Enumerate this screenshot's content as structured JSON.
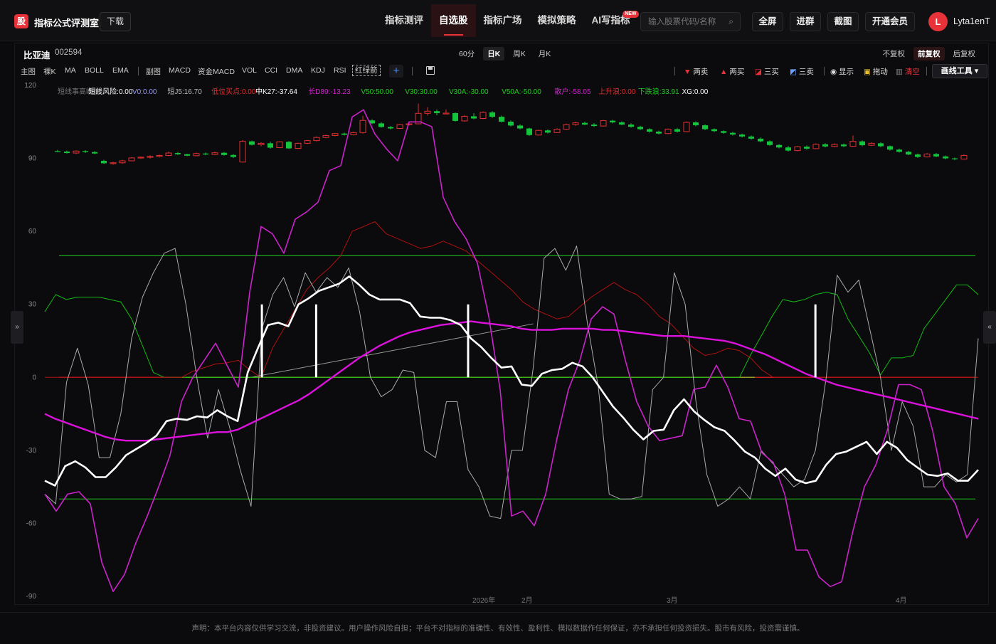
{
  "header": {
    "logo_char": "股",
    "app_title": "指标公式评测室",
    "download_label": "下载",
    "nav": [
      {
        "label": "指标测评",
        "active": false
      },
      {
        "label": "自选股",
        "active": true
      },
      {
        "label": "指标广场",
        "active": false
      },
      {
        "label": "模拟策略",
        "active": false
      },
      {
        "label": "AI写指标",
        "active": false,
        "badge": "NEW"
      }
    ],
    "search_placeholder": "输入股票代码/名称",
    "buttons": {
      "fullscreen": "全屏",
      "join_group": "进群",
      "screenshot": "截图",
      "vip": "开通会员"
    },
    "avatar_initial": "L",
    "username": "Lyta1enT"
  },
  "stock": {
    "name": "比亚迪",
    "code": "002594"
  },
  "periods": [
    {
      "label": "60分",
      "active": false
    },
    {
      "label": "日K",
      "active": true
    },
    {
      "label": "周K",
      "active": false
    },
    {
      "label": "月K",
      "active": false
    }
  ],
  "adjust": [
    {
      "label": "不复权",
      "active": false
    },
    {
      "label": "前复权",
      "active": true
    },
    {
      "label": "后复权",
      "active": false
    }
  ],
  "indicators_main": [
    "主图",
    "裸K",
    "MA",
    "BOLL",
    "EMA"
  ],
  "indicators_sub": [
    "副图",
    "MACD",
    "资金MACD",
    "VOL",
    "CCI",
    "DMA",
    "KDJ",
    "RSI",
    "红绿箭"
  ],
  "active_indicator": "红绿箭",
  "tools": {
    "sell2": "两卖",
    "buy2": "两买",
    "buy3": "三买",
    "sell3": "三卖",
    "show": "显示",
    "drag": "拖动",
    "clear": "清空",
    "draw_tools": "画线工具"
  },
  "legend": [
    {
      "text": "短线事高峰信",
      "color": "#777777"
    },
    {
      "text": "短线风险:0.00",
      "color": "#ffffff"
    },
    {
      "text": "V0:0.00",
      "color": "#9999ff"
    },
    {
      "text": "短J5:16.70",
      "color": "#bbbbbb"
    },
    {
      "text": "低位买点:0.00",
      "color": "#e23030"
    },
    {
      "text": "中K27:-37.64",
      "color": "#ffffff"
    },
    {
      "text": "长D89:-13.23",
      "color": "#cc22cc"
    },
    {
      "text": "V50:50.00",
      "color": "#22cc22"
    },
    {
      "text": "V30:30.00",
      "color": "#22cc22"
    },
    {
      "text": "V30A:-30.00",
      "color": "#22cc22"
    },
    {
      "text": "V50A:-50.00",
      "color": "#22cc22"
    },
    {
      "text": "散户:-58.05",
      "color": "#cc22cc"
    },
    {
      "text": "上升浪:0.00",
      "color": "#e23030"
    },
    {
      "text": "下跌浪:33.91",
      "color": "#22cc22"
    },
    {
      "text": "XG:0.00",
      "color": "#ffffff"
    }
  ],
  "chart_data": {
    "type": "line",
    "ylim": [
      -90,
      120
    ],
    "yticks": [
      120,
      90,
      60,
      30,
      0,
      -30,
      -60,
      -90
    ],
    "xtick_labels": [
      "2026年",
      "2月",
      "3月",
      "4月"
    ],
    "hlines": [
      {
        "value": 50,
        "color": "#1a9a1a"
      },
      {
        "value": -50,
        "color": "#1a9a1a"
      },
      {
        "value": 0,
        "color": "#e02020"
      }
    ],
    "candles": [
      [
        93,
        93.5,
        92.5,
        92.8
      ],
      [
        92.8,
        93.2,
        92,
        92.2
      ],
      [
        92.2,
        93.3,
        91.8,
        93
      ],
      [
        93,
        93.4,
        92.2,
        92.6
      ],
      [
        92.6,
        93,
        91.8,
        92
      ],
      [
        89,
        89.4,
        87.8,
        88
      ],
      [
        88,
        88.6,
        87.4,
        88.2
      ],
      [
        88.2,
        89.4,
        87.8,
        89
      ],
      [
        89,
        90.5,
        88.8,
        90.2
      ],
      [
        90.2,
        90.8,
        89.8,
        90.5
      ],
      [
        90.5,
        91.3,
        89.9,
        90.8
      ],
      [
        90.8,
        91.6,
        90.4,
        91.2
      ],
      [
        91.2,
        92.8,
        90.9,
        92.2
      ],
      [
        92.2,
        92.6,
        91.4,
        91.7
      ],
      [
        91.7,
        91.9,
        90.9,
        91.1
      ],
      [
        91.1,
        92.4,
        90.9,
        92
      ],
      [
        92,
        92.4,
        91.3,
        91.6
      ],
      [
        91.6,
        92.8,
        91.3,
        92.3
      ],
      [
        92.3,
        92.6,
        91.1,
        91.4
      ],
      [
        91.4,
        91.7,
        90.2,
        90.6
      ],
      [
        88.5,
        97.5,
        88.3,
        97
      ],
      [
        97,
        97.3,
        95.3,
        95.6
      ],
      [
        95.6,
        96.6,
        95,
        96.2
      ],
      [
        96.2,
        96.9,
        94,
        94.4
      ],
      [
        94.4,
        97,
        94.2,
        96.8
      ],
      [
        96.8,
        97.1,
        93.9,
        94.1
      ],
      [
        94.1,
        96.5,
        93.9,
        96.2
      ],
      [
        96.2,
        97.6,
        95.9,
        97.3
      ],
      [
        97.3,
        99,
        97,
        98.6
      ],
      [
        98.6,
        99.7,
        98.3,
        99.4
      ],
      [
        99.4,
        100.4,
        99.1,
        100.2
      ],
      [
        100.2,
        100.6,
        99.4,
        99.7
      ],
      [
        99.7,
        101,
        99.4,
        100.6
      ],
      [
        100.6,
        107.5,
        100.2,
        105.6
      ],
      [
        105.6,
        106.1,
        104.1,
        104.4
      ],
      [
        104.4,
        104.9,
        102.6,
        102.9
      ],
      [
        102.9,
        103.3,
        101.9,
        102.3
      ],
      [
        102.3,
        104.2,
        102.1,
        103.9
      ],
      [
        103.9,
        104.7,
        103.5,
        104.2
      ],
      [
        104.2,
        112.5,
        104,
        108.5
      ],
      [
        108.5,
        111,
        107.6,
        109.4
      ],
      [
        109.4,
        110.1,
        107.7,
        108.6
      ],
      [
        108.6,
        110.1,
        108.3,
        108.6
      ],
      [
        108.6,
        108.9,
        105.1,
        105.4
      ],
      [
        105.4,
        107.8,
        105.1,
        107.3
      ],
      [
        107.3,
        108.6,
        106.1,
        106.4
      ],
      [
        106.4,
        109.3,
        106.1,
        108.9
      ],
      [
        108.9,
        109.4,
        106.6,
        107.1
      ],
      [
        107.1,
        107.6,
        104.7,
        105.1
      ],
      [
        105.1,
        105.6,
        103.1,
        103.5
      ],
      [
        103.5,
        104,
        101.9,
        102.3
      ],
      [
        102.3,
        102.6,
        99.2,
        99.6
      ],
      [
        99.6,
        101.8,
        99.3,
        101.5
      ],
      [
        101.5,
        101.9,
        100.2,
        100.6
      ],
      [
        100.6,
        102.4,
        100.4,
        102
      ],
      [
        102,
        104.3,
        101.7,
        103.9
      ],
      [
        103.9,
        105.1,
        103.4,
        104.6
      ],
      [
        104.6,
        105.1,
        103.6,
        103.9
      ],
      [
        103.9,
        104.5,
        102.9,
        103.3
      ],
      [
        103.3,
        105.8,
        103.1,
        105.5
      ],
      [
        105.5,
        105.9,
        104.4,
        104.8
      ],
      [
        104.8,
        105.2,
        103.6,
        103.9
      ],
      [
        103.9,
        104.4,
        102.6,
        103
      ],
      [
        103,
        103.4,
        101.6,
        102
      ],
      [
        102,
        102.4,
        100.6,
        101
      ],
      [
        101,
        101.4,
        99.8,
        100.2
      ],
      [
        100.2,
        102.3,
        100,
        102
      ],
      [
        102,
        102.5,
        100.6,
        101
      ],
      [
        101,
        105.2,
        100.8,
        104.8
      ],
      [
        104.8,
        105.2,
        103.2,
        103.6
      ],
      [
        103.6,
        104,
        101.6,
        102
      ],
      [
        102,
        102.3,
        100.8,
        101.2
      ],
      [
        101.2,
        101.5,
        100.1,
        100.5
      ],
      [
        100.5,
        100.9,
        99.4,
        99.8
      ],
      [
        99.8,
        100.2,
        98.6,
        99
      ],
      [
        99,
        99.4,
        97.7,
        98.1
      ],
      [
        98.1,
        98.6,
        96.6,
        97
      ],
      [
        97,
        97.4,
        95.1,
        95.5
      ],
      [
        95.5,
        95.9,
        94.1,
        94.5
      ],
      [
        94.5,
        95.1,
        92.8,
        93.2
      ],
      [
        93.2,
        95.1,
        92.9,
        94.8
      ],
      [
        94.8,
        95.3,
        93.6,
        94
      ],
      [
        94,
        96.2,
        93.8,
        95.8
      ],
      [
        95.8,
        96.2,
        94.5,
        94.9
      ],
      [
        94.9,
        96.2,
        94.6,
        95.7
      ],
      [
        95.7,
        96.1,
        94.6,
        95
      ],
      [
        95,
        99.4,
        94.8,
        97
      ],
      [
        97,
        97.4,
        95,
        95.4
      ],
      [
        95.4,
        96.6,
        95.1,
        96.2
      ],
      [
        96.2,
        96.6,
        94.6,
        95
      ],
      [
        95,
        95.3,
        93.2,
        93.6
      ],
      [
        93.6,
        94,
        92.4,
        92.7
      ],
      [
        92.7,
        93.1,
        91.3,
        91.6
      ],
      [
        91.6,
        92,
        90.2,
        90.6
      ],
      [
        90.6,
        92.2,
        90.4,
        91.8
      ],
      [
        91.8,
        92.2,
        90.5,
        90.8
      ],
      [
        90.8,
        91.2,
        89.6,
        90
      ],
      [
        90,
        90.3,
        89.3,
        89.7
      ],
      [
        89.7,
        91.6,
        89.5,
        91.2
      ]
    ],
    "series": [
      {
        "name": "中K27",
        "color": "#ffffff",
        "width": 2.6,
        "values": [
          -42.5,
          -44.5,
          -36.5,
          -34.5,
          -37,
          -41,
          -41,
          -37,
          -32,
          -29.5,
          -27,
          -24,
          -18,
          -17,
          -17.5,
          -16,
          -16.5,
          -13.5,
          -16,
          -18,
          2,
          12,
          21.5,
          22.5,
          21,
          30,
          32.5,
          35.5,
          37,
          38.5,
          41.5,
          38,
          34,
          32,
          32,
          32,
          30.5,
          25,
          24.5,
          24.5,
          23.5,
          21.5,
          16,
          12.5,
          8,
          4,
          4.5,
          -3,
          -3.5,
          1.5,
          3,
          3.5,
          6,
          4.5,
          0,
          -6,
          -12,
          -16.5,
          -21.5,
          -25.5,
          -22,
          -21.5,
          -13.5,
          -9,
          -14,
          -17.5,
          -20.5,
          -22,
          -26,
          -30.5,
          -33,
          -37.5,
          -40.5,
          -37.5,
          -42,
          -43.5,
          -42.5,
          -36,
          -31.5,
          -30.5,
          -28.5,
          -26.5,
          -31.5,
          -26.5,
          -29,
          -34,
          -37,
          -40,
          -40.5,
          -39.5,
          -42.5,
          -42.5,
          -38
        ]
      },
      {
        "name": "长D89",
        "color": "#dd11dd",
        "width": 2.4,
        "values": [
          -15,
          -17,
          -18.5,
          -20,
          -21.5,
          -23,
          -24.5,
          -25.5,
          -26,
          -26,
          -26,
          -25.5,
          -25,
          -24.5,
          -24,
          -23.5,
          -23,
          -22.5,
          -22.5,
          -21.5,
          -19.5,
          -17.5,
          -15.5,
          -13.5,
          -11.5,
          -9.5,
          -7,
          -4,
          -1,
          2,
          5,
          8,
          10.5,
          13,
          15,
          17,
          18.5,
          19.5,
          20.5,
          21.5,
          22,
          22.5,
          23,
          22.5,
          22,
          21.5,
          21,
          20,
          19.5,
          19.5,
          19.5,
          20,
          20,
          20,
          20,
          19.5,
          19.5,
          19,
          18.5,
          18,
          17.5,
          17,
          17,
          17,
          16.5,
          16,
          15.5,
          15,
          14,
          12.5,
          11,
          9.5,
          7.5,
          5.5,
          3.5,
          1.5,
          0,
          -1.5,
          -3,
          -4,
          -5,
          -6,
          -7,
          -8,
          -9,
          -10,
          -11,
          -12,
          -13,
          -14,
          -15,
          -16,
          -17
        ]
      },
      {
        "name": "散户",
        "color": "#cc22cc",
        "width": 1.6,
        "values": [
          -48,
          -55,
          -48,
          -47,
          -52,
          -76,
          -88,
          -81,
          -68,
          -57,
          -45,
          -32,
          -10,
          0,
          7,
          14,
          5,
          -4,
          35,
          62,
          59,
          51,
          65,
          68,
          72,
          85,
          87,
          107,
          110,
          100,
          94,
          89,
          105,
          105,
          103,
          74,
          64,
          57,
          47,
          25,
          -5,
          -57,
          -55,
          -61,
          -48,
          -25,
          -5,
          7,
          24,
          29,
          26,
          7,
          -10,
          -20,
          -26,
          -25,
          -24,
          -5,
          -4,
          5,
          -4,
          -17,
          -18,
          -31,
          -35,
          -48,
          -71,
          -71,
          -82,
          -86,
          -84,
          -63,
          -45,
          -36,
          -22,
          -3,
          -3,
          -5,
          -22,
          -45,
          -52,
          -66,
          -58
        ]
      },
      {
        "name": "短J5",
        "color": "#aaaaaa",
        "width": 1,
        "values": [
          -48,
          -52,
          -2,
          12,
          -3,
          -33,
          -33,
          -15,
          16,
          33,
          43,
          51,
          53,
          30,
          0,
          -25,
          -5,
          -20,
          -38,
          -53,
          20,
          34,
          41,
          29,
          43,
          35,
          41,
          37,
          45,
          27,
          0,
          -8,
          -5,
          3,
          2,
          -30,
          -33,
          -10,
          -10,
          -38,
          -45,
          -57,
          -58,
          -30,
          -30,
          4,
          49,
          53,
          44,
          54,
          22,
          -4,
          -48,
          -50,
          -50,
          -49,
          -5,
          0,
          43,
          30,
          -10,
          -40,
          -53,
          -50,
          -45,
          -50,
          -30,
          -35,
          -40,
          -45,
          -42,
          -30,
          0,
          42,
          35,
          40,
          20,
          0,
          -30,
          -10,
          -20,
          -45,
          -45,
          -40,
          -43,
          -40,
          16
        ]
      },
      {
        "name": "低位买点",
        "color": "#b01010",
        "width": 1,
        "values": [
          0,
          0,
          0,
          0,
          0,
          0,
          0,
          0,
          0,
          0,
          0,
          0,
          0,
          2.5,
          4,
          5.5,
          6,
          7,
          3,
          0,
          12,
          20,
          28,
          36,
          41,
          45,
          50,
          60,
          62,
          64,
          59,
          57,
          55,
          53,
          54,
          56,
          54,
          52,
          48,
          44,
          40,
          36,
          31,
          28,
          26,
          24,
          25,
          29,
          33,
          36,
          39,
          36,
          34,
          30,
          25,
          22,
          17,
          12,
          9,
          10,
          12,
          11,
          8,
          3,
          0,
          0,
          0,
          0,
          0,
          0,
          0,
          0,
          0,
          0,
          0,
          0,
          0,
          0,
          0,
          0,
          0,
          0,
          0
        ]
      },
      {
        "name": "下跌浪",
        "color": "#11bb11",
        "width": 1,
        "values": [
          27,
          34,
          32,
          33,
          33,
          33,
          32,
          31,
          24,
          13,
          2,
          0,
          0,
          0,
          0,
          0,
          0,
          0,
          0,
          0,
          0,
          0,
          0,
          0,
          0,
          0,
          0,
          0,
          0,
          0,
          0,
          0,
          0,
          0,
          0,
          0,
          0,
          0,
          0,
          0,
          0,
          0,
          0,
          0,
          0,
          0,
          0,
          0,
          0,
          0,
          0,
          0,
          0,
          0,
          0,
          0,
          0,
          0,
          0,
          0,
          0,
          0,
          0,
          0,
          0,
          9,
          17,
          25,
          32,
          31,
          32,
          34,
          35,
          34,
          24,
          17,
          10,
          1,
          8,
          8,
          9,
          20,
          26,
          32,
          38,
          38,
          34
        ]
      },
      {
        "name": "V0",
        "color": "#888822",
        "width": 1.4,
        "values": [
          0,
          0
        ]
      }
    ],
    "white_bars": [
      {
        "x": 20,
        "top": 30
      },
      {
        "x": 25,
        "top": 30
      },
      {
        "x": 39,
        "top": 30
      },
      {
        "x": 71,
        "top": 30
      }
    ],
    "trend_line": {
      "from": [
        19,
        0
      ],
      "to": [
        45,
        22
      ],
      "color": "#999999"
    }
  },
  "footer": "声明：本平台内容仅供学习交流，非投资建议。用户操作风险自担；平台不对指标的准确性、有效性、盈利性、模拟数据作任何保证，亦不承担任何投资损失。股市有风险，投资需谨慎。"
}
